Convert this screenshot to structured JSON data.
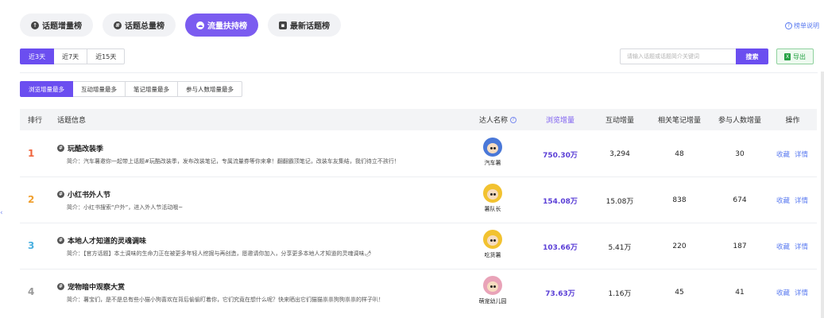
{
  "top_tabs": [
    {
      "label": "话题增量榜",
      "icon": "arrow-up-icon",
      "glyph": "↑"
    },
    {
      "label": "话题总量榜",
      "icon": "hash-icon",
      "glyph": "#"
    },
    {
      "label": "流量扶持榜",
      "icon": "cloud-icon",
      "glyph": "☁"
    },
    {
      "label": "最新话题榜",
      "icon": "comment-icon",
      "glyph": "▪"
    }
  ],
  "active_top_tab": 2,
  "help_link": "榜单说明",
  "period_tabs": [
    "近3天",
    "近7天",
    "近15天"
  ],
  "active_period": 0,
  "search": {
    "placeholder": "请输入话题或话题简介关键词",
    "button": "搜索"
  },
  "export_label": "导出",
  "sort_tabs": [
    "浏览增量最多",
    "互动增量最多",
    "笔记增量最多",
    "参与人数增量最多"
  ],
  "active_sort": 0,
  "columns": {
    "rank": "排行",
    "topic": "话题信息",
    "author": "达人名称",
    "views": "浏览增量",
    "interactions": "互动增量",
    "notes": "相关笔记增量",
    "participants": "参与人数增量",
    "ops": "操作"
  },
  "rows": [
    {
      "rank": "1",
      "rank_color": "#f0643c",
      "title": "玩酷改装季",
      "desc": "简介：汽车薯邀你一起带上话题#玩酷改装季，发布改装笔记，专属流量券等你来拿！翻翻霸顶笔记，改装车友集结，我们待立不孩行！",
      "author": "汽车薯",
      "avatar_color": "#4a78d8",
      "views": "750.30万",
      "interactions": "3,294",
      "notes": "48",
      "participants": "30",
      "op_collect": "收藏",
      "op_detail": "详情"
    },
    {
      "rank": "2",
      "rank_color": "#f0a030",
      "title": "小红书外人节",
      "desc": "简介：小红书搜索“户外”，进入外人节活动哦~",
      "author": "薯队长",
      "avatar_color": "#f2c230",
      "views": "154.08万",
      "interactions": "15.08万",
      "notes": "838",
      "participants": "674",
      "op_collect": "收藏",
      "op_detail": "详情"
    },
    {
      "rank": "3",
      "rank_color": "#4ab0e0",
      "title": "本地人才知道的灵魂调味",
      "desc": "简介：【官方话题】本土调味的生命力正在被更多年轻人挖掘与再创造，愿邀请你加入，分享更多本地人才知道的灵魂调味🌶",
      "author": "吃货薯",
      "avatar_color": "#f2c230",
      "views": "103.66万",
      "interactions": "5.41万",
      "notes": "220",
      "participants": "187",
      "op_collect": "收藏",
      "op_detail": "详情"
    },
    {
      "rank": "4",
      "rank_color": "#999999",
      "title": "宠物暗中观察大赏",
      "desc": "简介：薯宝们，是不是总有些小猫小狗喜欢在背后偷偷盯着你，它们究竟在想什么呢？快来晒出它们猫猫祟祟狗狗祟祟的样子叭！",
      "author": "萌宠幼儿园",
      "avatar_color": "#e9a3b8",
      "views": "73.63万",
      "interactions": "1.16万",
      "notes": "45",
      "participants": "41",
      "op_collect": "收藏",
      "op_detail": "详情"
    }
  ]
}
